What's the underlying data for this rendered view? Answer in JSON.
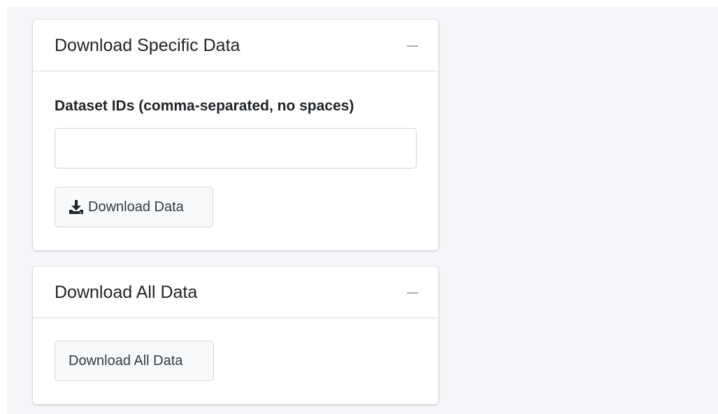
{
  "panels": {
    "specific": {
      "title": "Download Specific Data",
      "collapse_symbol": "—",
      "field_label": "Dataset IDs (comma-separated, no spaces)",
      "input_value": "",
      "input_placeholder": "",
      "button_label": "Download Data",
      "button_icon": "download-icon"
    },
    "all": {
      "title": "Download All Data",
      "collapse_symbol": "—",
      "button_label": "Download All Data"
    }
  },
  "colors": {
    "page_background": "#f4f6f9",
    "card_background": "#ffffff",
    "button_background": "#f8f9fa",
    "text": "#212529"
  }
}
